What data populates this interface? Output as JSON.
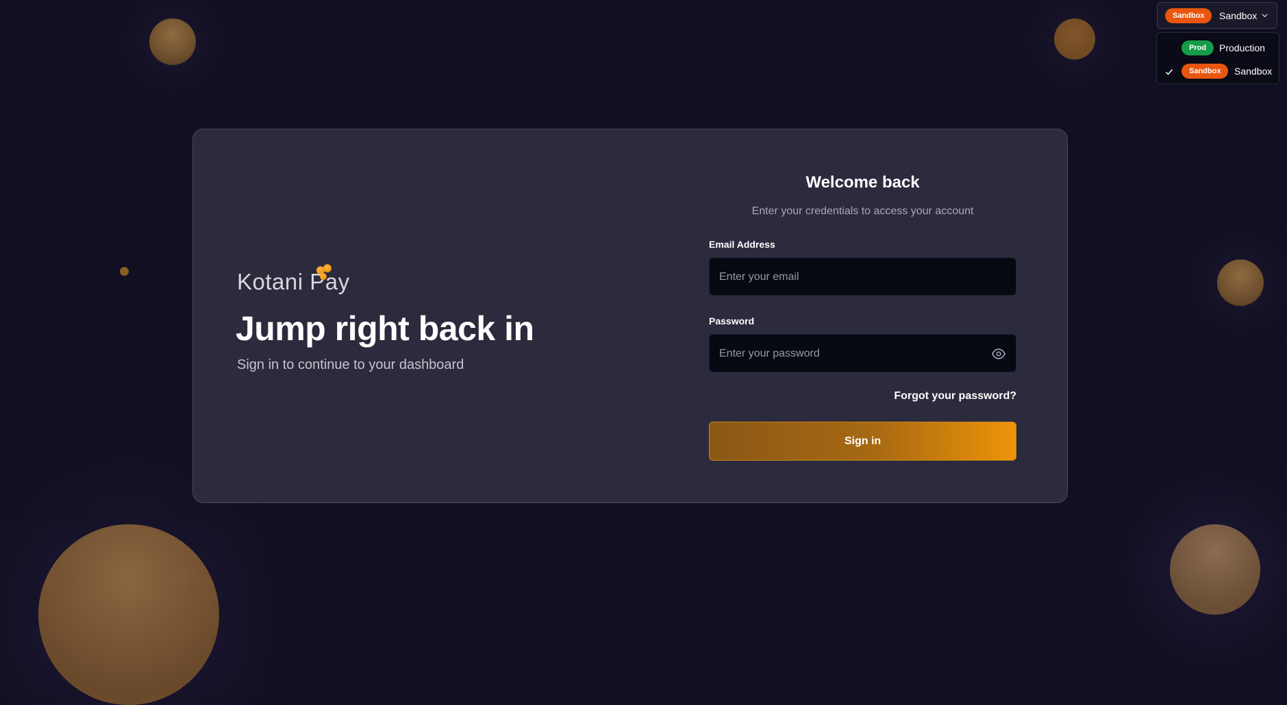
{
  "brand": {
    "logo_text": "Kotani Pay"
  },
  "hero": {
    "title": "Jump right back in",
    "subtitle": "Sign in to continue to your dashboard"
  },
  "form": {
    "title": "Welcome back",
    "subtitle": "Enter your credentials to access your account",
    "email_label": "Email Address",
    "email_placeholder": "Enter your email",
    "email_value": "",
    "password_label": "Password",
    "password_placeholder": "Enter your password",
    "password_value": "",
    "forgot_link": "Forgot your password?",
    "submit_label": "Sign in"
  },
  "environment": {
    "current_badge": "Sandbox",
    "current_label": "Sandbox",
    "options": [
      {
        "badge": "Prod",
        "label": "Production",
        "selected": false,
        "color": "#169b48"
      },
      {
        "badge": "Sandbox",
        "label": "Sandbox",
        "selected": true,
        "color": "#e8560f"
      }
    ]
  },
  "colors": {
    "background": "#110f22",
    "card": "#2c2a3d",
    "accent_orange": "#ef9408",
    "sandbox_badge": "#e8560f",
    "prod_badge": "#169b48"
  },
  "icons": [
    "eye-icon",
    "chevron-down-icon",
    "check-icon"
  ]
}
